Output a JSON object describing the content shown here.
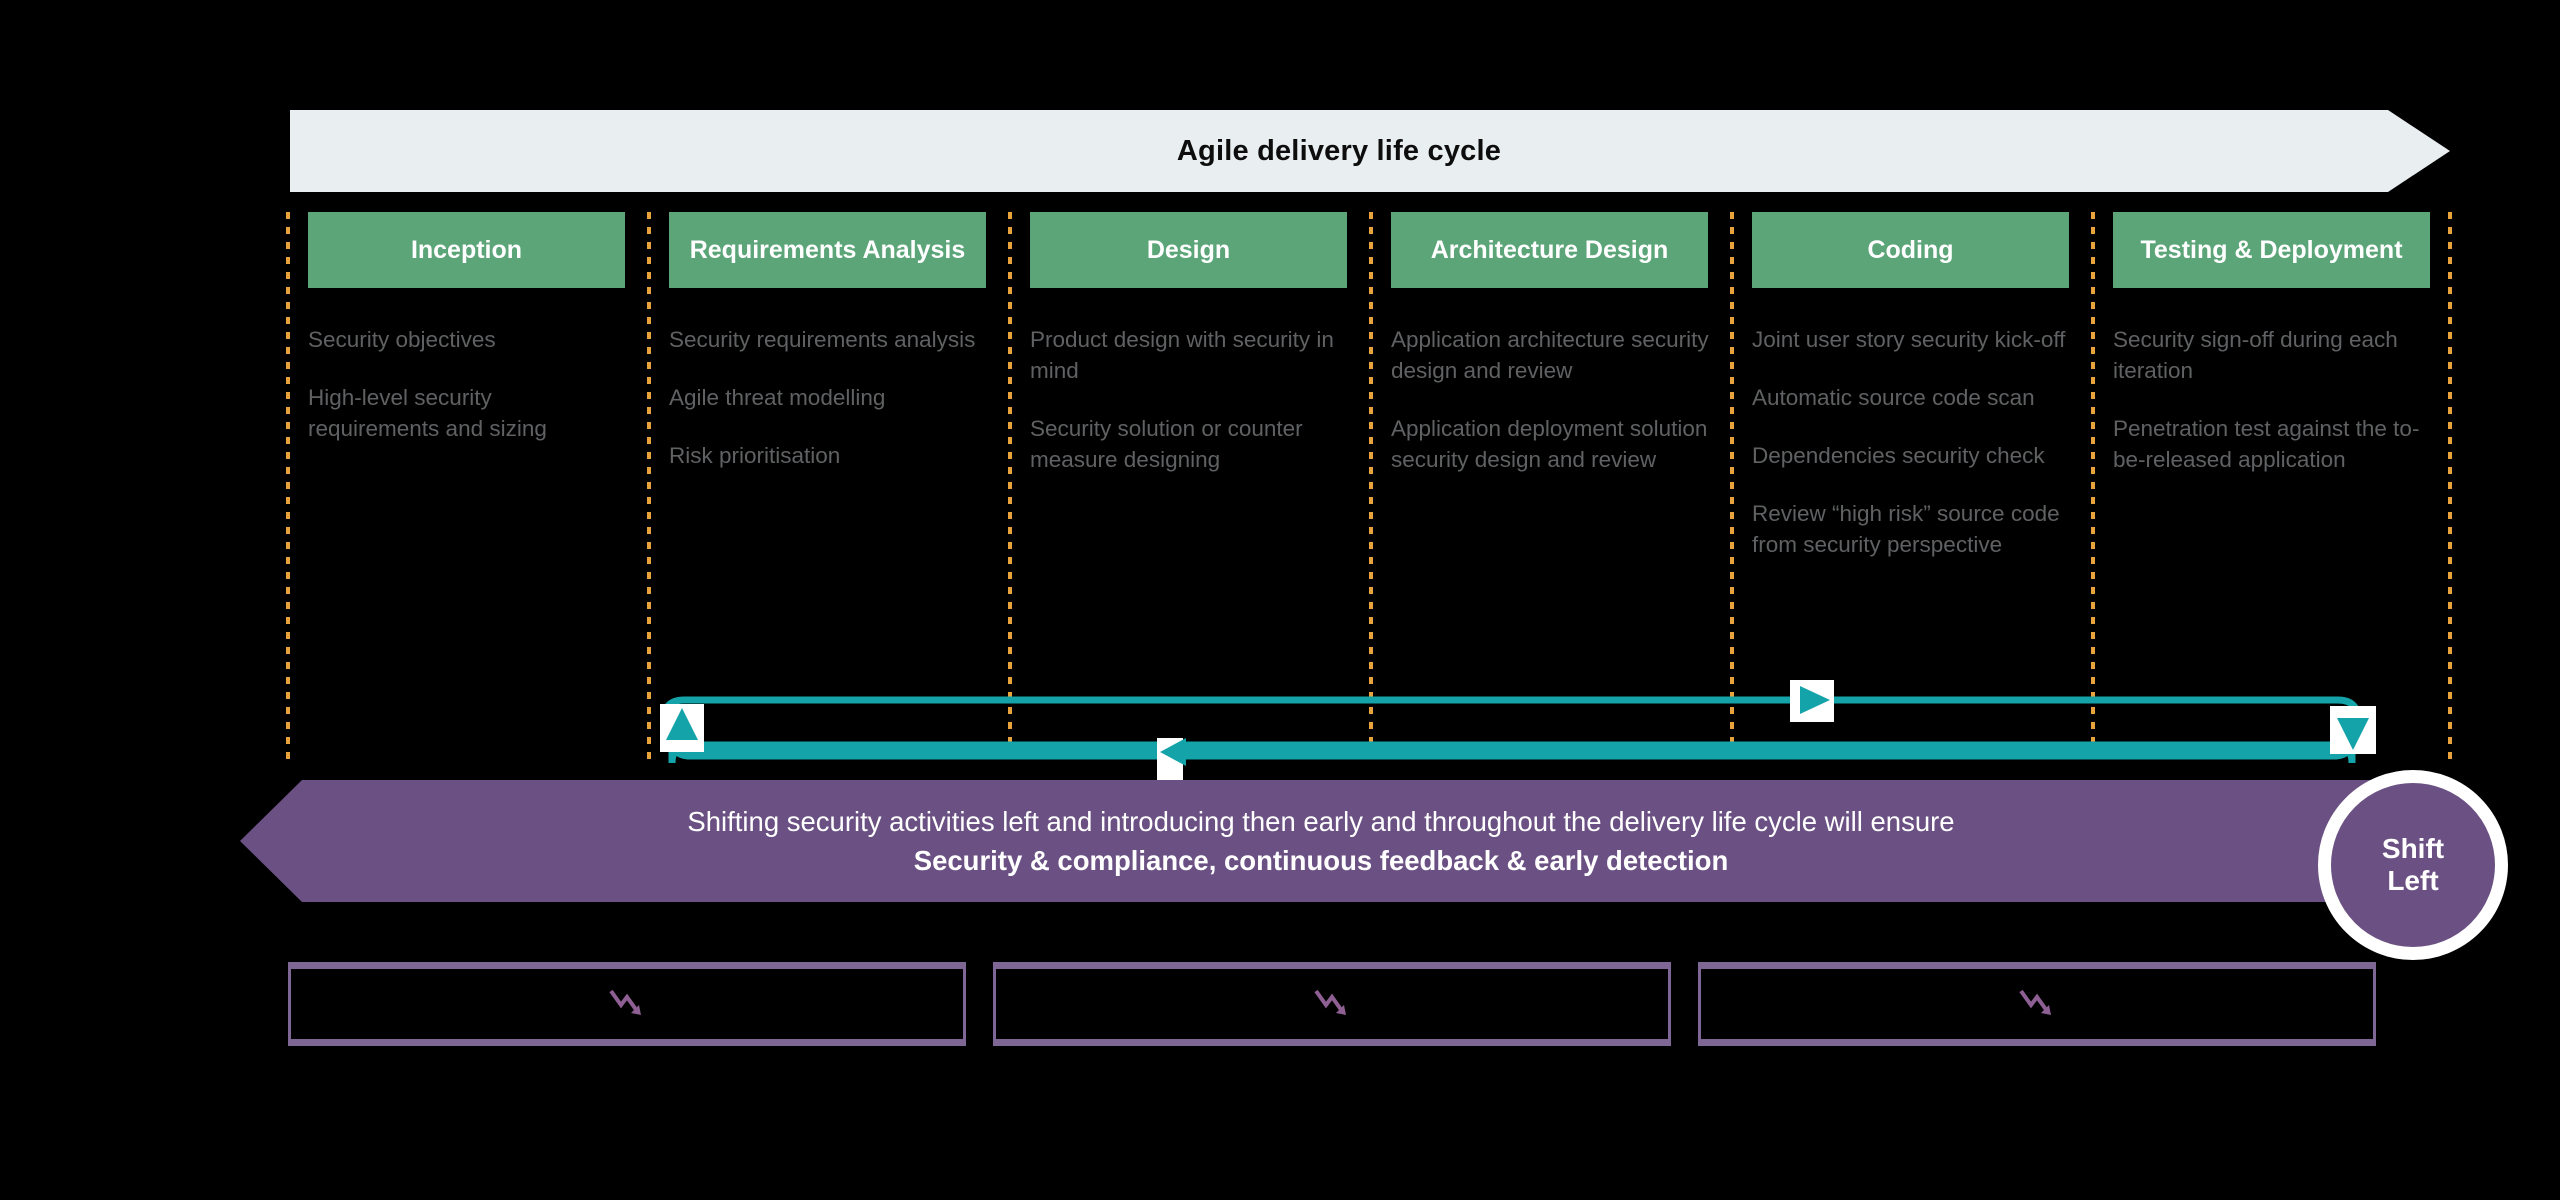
{
  "top_banner": {
    "title": "Agile delivery life cycle",
    "background_color": "#e9eef0",
    "shape": "right-arrow"
  },
  "phases": [
    {
      "header": "Inception",
      "items": [
        "Security objectives",
        "High-level security requirements and sizing"
      ]
    },
    {
      "header": "Requirements Analysis",
      "items": [
        "Security requirements analysis",
        "Agile threat modelling",
        "Risk prioritisation"
      ]
    },
    {
      "header": "Design",
      "items": [
        "Product design with security in mind",
        "Security solution or counter measure designing"
      ]
    },
    {
      "header": "Architecture Design",
      "items": [
        "Application architecture security design and review",
        "Application deployment solution security design and review"
      ]
    },
    {
      "header": "Coding",
      "items": [
        "Joint user story security kick-off",
        "Automatic source code scan",
        "Dependencies security check",
        "Review “high risk” source code from security perspective"
      ]
    },
    {
      "header": "Testing & Deployment",
      "items": [
        "Security sign-off during each iteration",
        "Penetration test against the to-be-released application"
      ]
    }
  ],
  "feedback_loop": {
    "color": "#14a3a8",
    "description": "continuous feedback loop arrows",
    "markers": [
      "arrow-up-left",
      "arrow-left-middle",
      "arrow-right-top",
      "arrow-down-right"
    ]
  },
  "purple_banner": {
    "line1": "Shifting security activities left and introducing then early and throughout the delivery life cycle will ensure",
    "line2": "Security & compliance, continuous feedback & early detection",
    "background_color": "#6b5183",
    "shape": "left-arrow"
  },
  "shift_badge": {
    "line1": "Shift",
    "line2": "Left",
    "background_color": "#6b5183",
    "ring_color": "#ffffff"
  },
  "bottom_boxes": [
    {
      "icon": "trend-down-icon"
    },
    {
      "icon": "trend-down-icon"
    },
    {
      "icon": "trend-down-icon"
    }
  ],
  "colors": {
    "background": "#000000",
    "header_green": "#5ba578",
    "divider_orange": "#e8a33d",
    "body_text_gray": "#5f6163",
    "teal": "#14a3a8",
    "purple": "#6b5183",
    "box_border_purple": "#7e6795"
  }
}
